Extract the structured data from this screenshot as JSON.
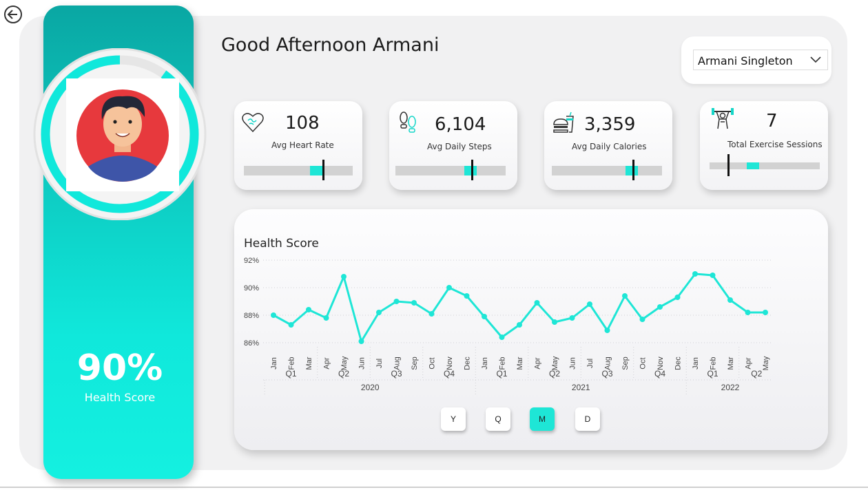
{
  "header": {
    "greeting": "Good Afternoon Armani",
    "user_select": {
      "selected": "Armani Singleton"
    }
  },
  "nav": {
    "back_icon": "back-arrow-icon"
  },
  "profile": {
    "avatar_icon": "person-avatar",
    "health_score_value": "90%",
    "health_score_label": "Health Score",
    "ring_progress": 0.9
  },
  "kpis": [
    {
      "icon": "heart-icon",
      "value": "108",
      "label": "Avg Heart Rate",
      "fill": 0.72,
      "target": 0.72
    },
    {
      "icon": "footsteps-icon",
      "value": "6,104",
      "label": "Avg Daily Steps",
      "fill": 0.74,
      "target": 0.69
    },
    {
      "icon": "food-drink-icon",
      "value": "3,359",
      "label": "Avg Daily Calories",
      "fill": 0.78,
      "target": 0.73
    },
    {
      "icon": "weightlifting-icon",
      "value": "7",
      "label": "Total Exercise Sessions",
      "fill": 0.45,
      "target": 0.16
    }
  ],
  "chart_data": {
    "type": "line",
    "title": "Health Score",
    "xlabel": "",
    "ylabel": "",
    "ylim": [
      86,
      92
    ],
    "yticks": [
      "86%",
      "88%",
      "90%",
      "92%"
    ],
    "grid": true,
    "color": "#1ee6d6",
    "categories": [
      "Jan",
      "Feb",
      "Mar",
      "Apr",
      "May",
      "Jun",
      "Jul",
      "Aug",
      "Sep",
      "Oct",
      "Nov",
      "Dec",
      "Jan",
      "Feb",
      "Mar",
      "Apr",
      "May",
      "Jun",
      "Jul",
      "Aug",
      "Sep",
      "Oct",
      "Nov",
      "Dec",
      "Jan",
      "Feb",
      "Mar",
      "Apr",
      "May"
    ],
    "quarters": [
      {
        "label": "Q1",
        "span": 3
      },
      {
        "label": "Q2",
        "span": 3
      },
      {
        "label": "Q3",
        "span": 3
      },
      {
        "label": "Q4",
        "span": 3
      },
      {
        "label": "Q1",
        "span": 3
      },
      {
        "label": "Q2",
        "span": 3
      },
      {
        "label": "Q3",
        "span": 3
      },
      {
        "label": "Q4",
        "span": 3
      },
      {
        "label": "Q1",
        "span": 3
      },
      {
        "label": "Q2",
        "span": 2
      }
    ],
    "years": [
      {
        "label": "2020",
        "span": 12
      },
      {
        "label": "2021",
        "span": 12
      },
      {
        "label": "2022",
        "span": 5
      }
    ],
    "values": [
      88.0,
      87.3,
      88.4,
      87.8,
      90.8,
      86.1,
      88.2,
      89.0,
      88.9,
      88.1,
      90.0,
      89.4,
      87.9,
      86.4,
      87.3,
      88.9,
      87.5,
      87.8,
      88.8,
      86.9,
      89.4,
      87.7,
      88.6,
      89.3,
      91.0,
      90.9,
      89.1,
      88.2,
      88.2
    ]
  },
  "granularity": {
    "buttons": [
      "Y",
      "Q",
      "M",
      "D"
    ],
    "active": "M"
  }
}
